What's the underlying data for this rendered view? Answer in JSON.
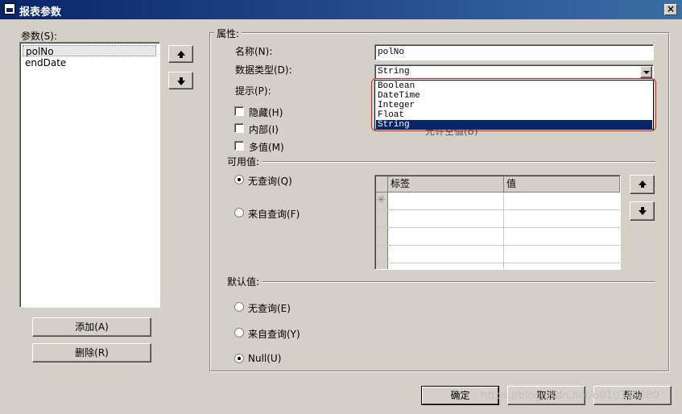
{
  "window": {
    "title": "报表参数",
    "close_label": "×"
  },
  "params": {
    "label": "参数(S):",
    "items": [
      "polNo",
      "endDate"
    ],
    "add_label": "添加(A)",
    "delete_label": "删除(R)"
  },
  "attributes": {
    "group_label": "属性:",
    "name_label": "名称(N):",
    "name_value": "polNo",
    "type_label": "数据类型(D):",
    "type_value": "String",
    "type_options": [
      "Boolean",
      "DateTime",
      "Integer",
      "Float",
      "String"
    ],
    "prompt_label": "提示(P):",
    "hidden_label": "隐藏(H)",
    "internal_label": "内部(I)",
    "multi_label": "多值(M)",
    "hidden_ghost_text": "允许空值(B)"
  },
  "available": {
    "label": "可用值:",
    "no_query_label": "无查询(Q)",
    "from_query_label": "来自查询(F)",
    "grid_headers": [
      "标签",
      "值"
    ],
    "new_row_marker": "✳"
  },
  "default": {
    "label": "默认值:",
    "no_query_label": "无查询(E)",
    "from_query_label": "来自查询(Y)",
    "null_label": "Null(U)"
  },
  "buttons": {
    "ok": "确定",
    "cancel": "取消",
    "help": "帮助"
  },
  "watermark": "https://blog.csdn.net/u010349380",
  "colors": {
    "title_bar": "#0a246a",
    "selection": "#0a246a",
    "highlight_box": "#cc2222",
    "face": "#d4d0c8"
  }
}
